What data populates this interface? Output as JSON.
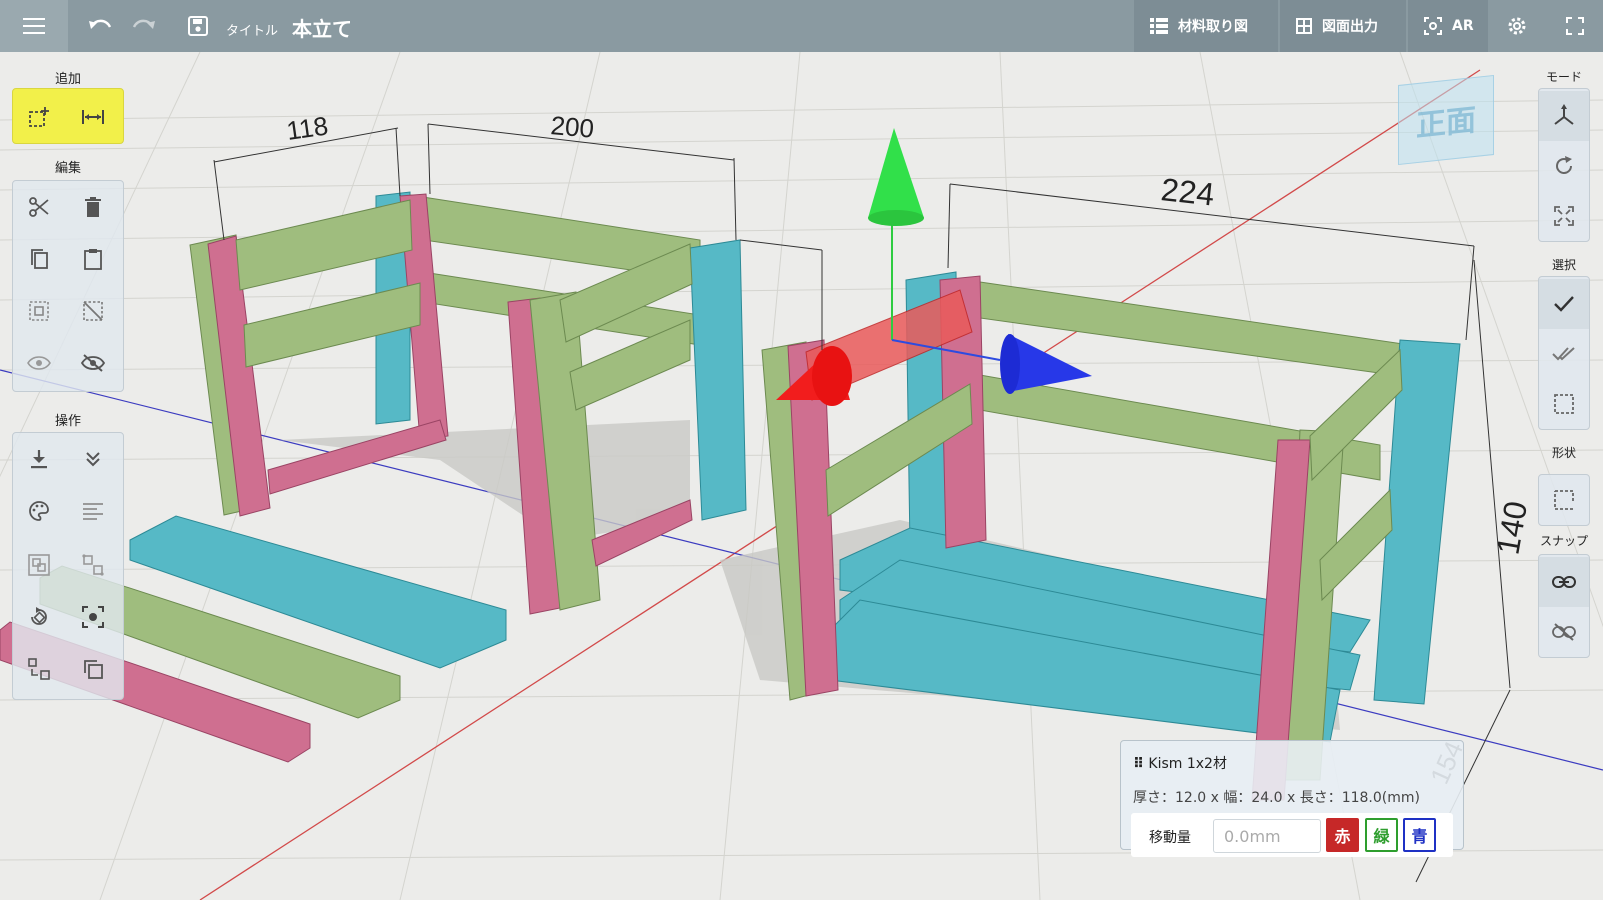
{
  "topbar": {
    "title_label": "タイトル",
    "title_value": "本立て",
    "cut_list_label": "材料取り図",
    "drawing_label": "図面出力",
    "ar_label": "AR",
    "icons": [
      "menu-icon",
      "undo-icon",
      "redo-icon",
      "save-icon",
      "list-icon",
      "grid-icon",
      "ar-icon",
      "gear-icon",
      "fullscreen-icon"
    ]
  },
  "left_toolbar": {
    "add_label": "追加",
    "edit_label": "編集",
    "operate_label": "操作"
  },
  "right_toolbar": {
    "mode_label": "モード",
    "select_label": "選択",
    "shape_label": "形状",
    "snap_label": "スナップ"
  },
  "viewcube": {
    "label": "正面"
  },
  "dimensions": {
    "d118": "118",
    "d200": "200",
    "d224": "224",
    "d140": "140",
    "d154": "154"
  },
  "info_panel": {
    "name": "Kism 1x2材",
    "dims": "厚さ：12.0 x 幅：24.0 x 長さ：118.0(mm)",
    "move_label": "移動量",
    "move_placeholder": "0.0mm",
    "red_label": "赤",
    "green_label": "緑",
    "blue_label": "青"
  },
  "colors": {
    "pink": "#cf6f90",
    "green": "#9fbd7e",
    "cyan": "#56b9c6",
    "topbar": "#8a9aa1",
    "highlight": "#f2f04a"
  }
}
